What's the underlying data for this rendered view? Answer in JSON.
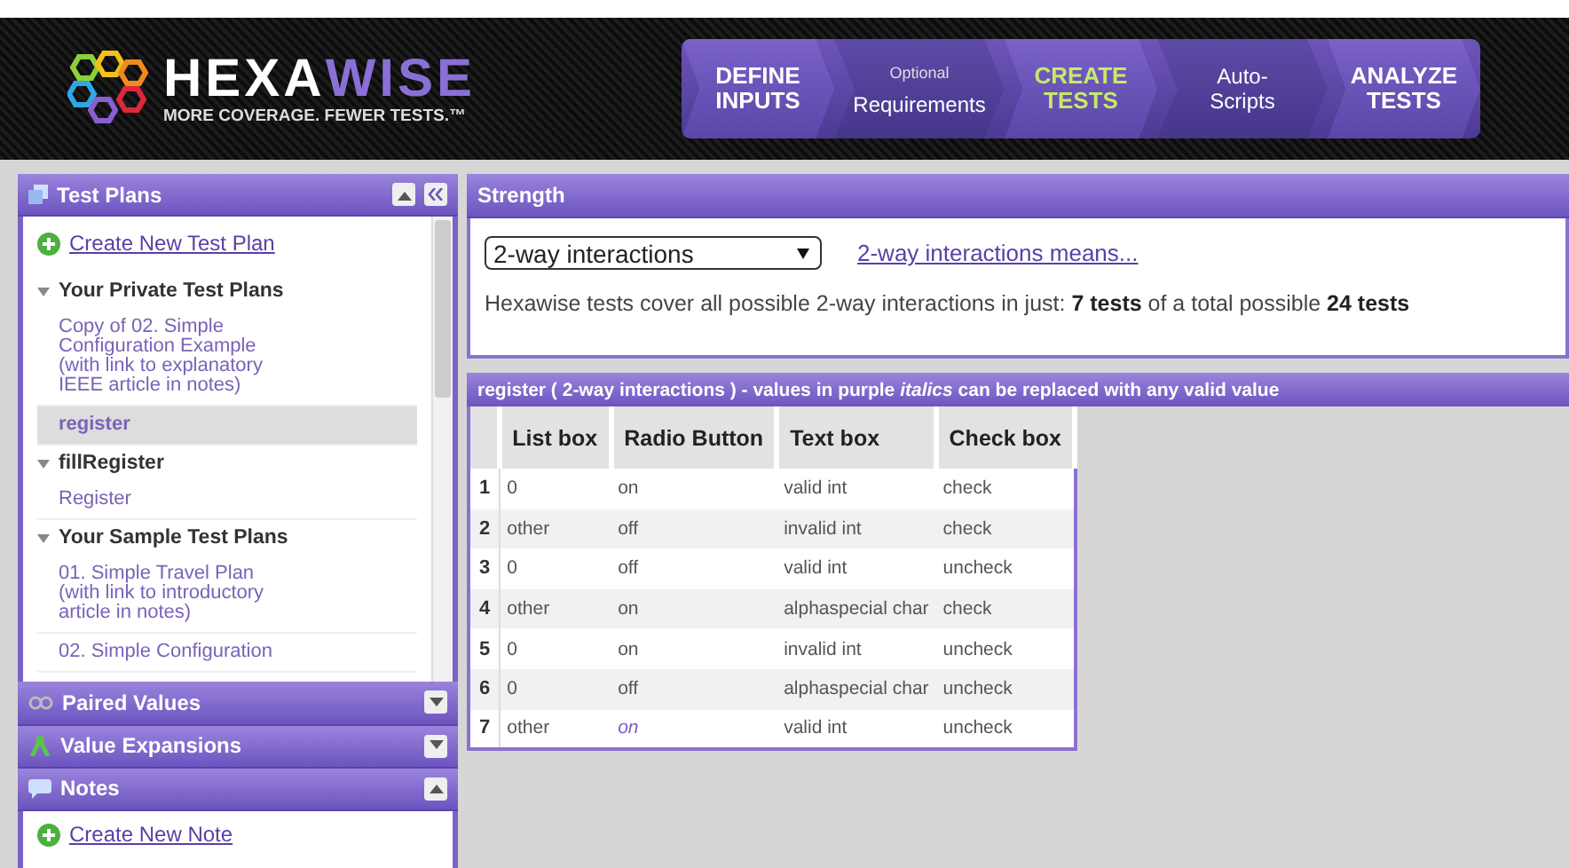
{
  "logo": {
    "name_a": "HEXA",
    "name_b": "WISE",
    "tagline": "MORE COVERAGE. FEWER TESTS.™"
  },
  "steps": [
    {
      "label": "DEFINE INPUTS",
      "selected": false,
      "kind": "main"
    },
    {
      "label": "Requirements",
      "note": "Optional",
      "selected": false,
      "kind": "sub"
    },
    {
      "label": "CREATE TESTS",
      "selected": true,
      "kind": "main"
    },
    {
      "label": "Auto-Scripts",
      "selected": false,
      "kind": "sub"
    },
    {
      "label": "ANALYZE TESTS",
      "selected": false,
      "kind": "main"
    }
  ],
  "sidebar": {
    "title": "Test Plans",
    "create_link": "Create New Test Plan",
    "groups": [
      {
        "title": "Your Private Test Plans",
        "expanded": true,
        "items": [
          {
            "label": "Copy of 02. Simple Configuration Example (with link to explanatory IEEE article in notes)",
            "selected": false
          },
          {
            "label": "register",
            "selected": true
          }
        ]
      },
      {
        "title": "fillRegister",
        "expanded": true,
        "items": [
          {
            "label": "Register",
            "selected": false
          }
        ]
      },
      {
        "title": "Your Sample Test Plans",
        "expanded": true,
        "items": [
          {
            "label": "01. Simple Travel Plan (with link to introductory article in notes)",
            "selected": false
          },
          {
            "label": "02. Simple Configuration",
            "selected": false
          }
        ]
      }
    ],
    "sections": [
      {
        "title": "Paired Values",
        "kind": "paired",
        "expanded": false
      },
      {
        "title": "Value Expansions",
        "kind": "expansions",
        "expanded": false
      },
      {
        "title": "Notes",
        "kind": "notes",
        "expanded": true
      }
    ],
    "notes_link": "Create New Note"
  },
  "strength": {
    "title": "Strength",
    "select_value": "2-way interactions",
    "help_link": "2-way interactions means...",
    "summary": "Hexawise tests cover all possible 2-way interactions in just: **7 tests** of a total possible **24 tests**"
  },
  "table": {
    "title": "register  ( 2-way interactions ) - values in purple *italics* can be replaced with any valid value",
    "columns": [
      "List box",
      "Radio Button",
      "Text box",
      "Check box"
    ],
    "rows": [
      {
        "number": "1",
        "cells": [
          {
            "text": "0",
            "replaceable": false
          },
          {
            "text": "on",
            "replaceable": false
          },
          {
            "text": "valid int",
            "replaceable": false
          },
          {
            "text": "check",
            "replaceable": false
          }
        ]
      },
      {
        "number": "2",
        "cells": [
          {
            "text": "other",
            "replaceable": false
          },
          {
            "text": "off",
            "replaceable": false
          },
          {
            "text": "invalid int",
            "replaceable": false
          },
          {
            "text": "check",
            "replaceable": false
          }
        ]
      },
      {
        "number": "3",
        "cells": [
          {
            "text": "0",
            "replaceable": false
          },
          {
            "text": "off",
            "replaceable": false
          },
          {
            "text": "valid int",
            "replaceable": false
          },
          {
            "text": "uncheck",
            "replaceable": false
          }
        ]
      },
      {
        "number": "4",
        "cells": [
          {
            "text": "other",
            "replaceable": false
          },
          {
            "text": "on",
            "replaceable": false
          },
          {
            "text": "alphaspecial char",
            "replaceable": false
          },
          {
            "text": "check",
            "replaceable": false
          }
        ]
      },
      {
        "number": "5",
        "cells": [
          {
            "text": "0",
            "replaceable": false
          },
          {
            "text": "on",
            "replaceable": false
          },
          {
            "text": "invalid int",
            "replaceable": false
          },
          {
            "text": "uncheck",
            "replaceable": false
          }
        ]
      },
      {
        "number": "6",
        "cells": [
          {
            "text": "0",
            "replaceable": false
          },
          {
            "text": "off",
            "replaceable": false
          },
          {
            "text": "alphaspecial char",
            "replaceable": false
          },
          {
            "text": "uncheck",
            "replaceable": false
          }
        ]
      },
      {
        "number": "7",
        "cells": [
          {
            "text": "other",
            "replaceable": false
          },
          {
            "text": "on",
            "replaceable": true
          },
          {
            "text": "valid int",
            "replaceable": false
          },
          {
            "text": "uncheck",
            "replaceable": false
          }
        ]
      }
    ]
  }
}
